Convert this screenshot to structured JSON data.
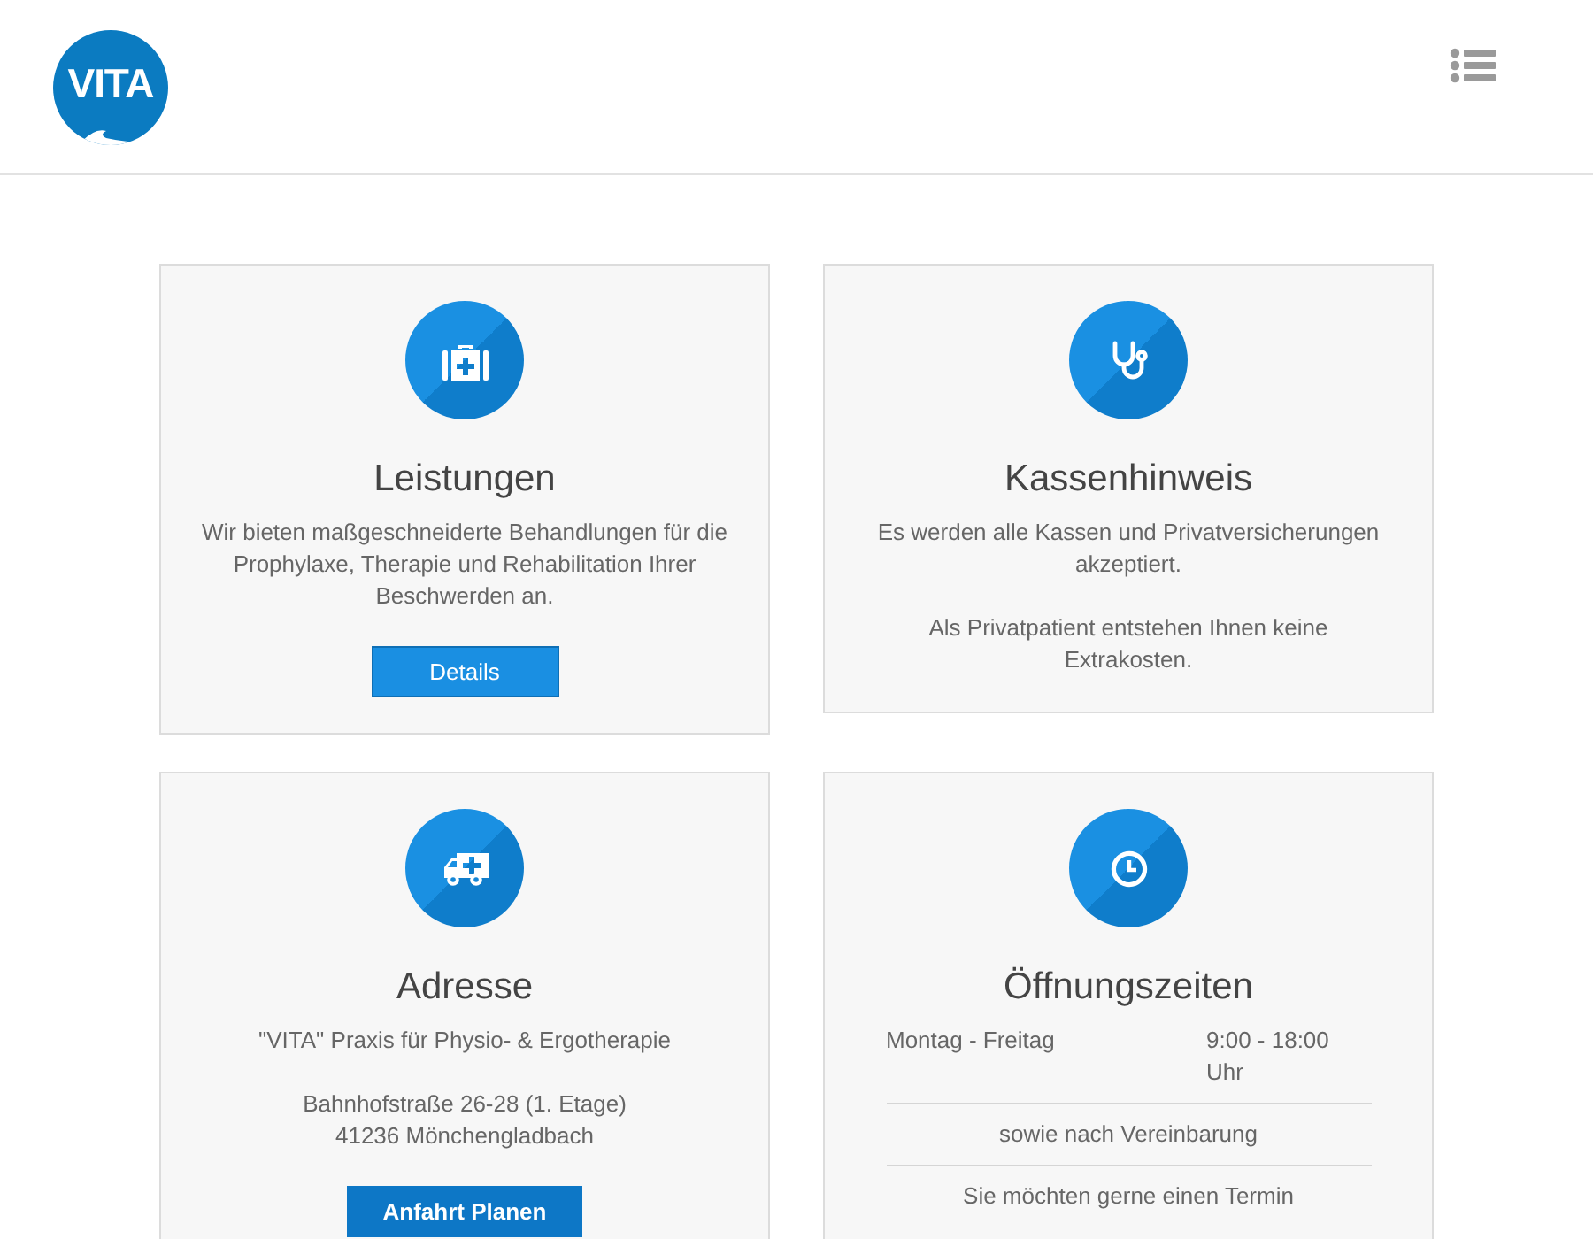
{
  "header": {
    "logo_text": "VITA"
  },
  "cards": [
    {
      "title": "Leistungen",
      "blocks": [
        {
          "kind": "paragraph",
          "lines": [
            "Wir bieten maßgeschneiderte Behandlungen für die Prophylaxe, Therapie und Rehabilitation Ihrer Beschwerden an."
          ]
        },
        {
          "kind": "button",
          "label": "Details",
          "bold": false
        }
      ]
    },
    {
      "title": "Kassenhinweis",
      "blocks": [
        {
          "kind": "paragraph",
          "lines": [
            "Es werden alle Kassen und Privatversicherungen akzeptiert."
          ]
        },
        {
          "kind": "paragraph",
          "lines": [
            "Als Privatpatient entstehen Ihnen keine Extrakosten."
          ]
        }
      ]
    },
    {
      "title": "Adresse",
      "blocks": [
        {
          "kind": "paragraph",
          "lines": [
            "\"VITA\" Praxis für Physio- & Ergotherapie"
          ]
        },
        {
          "kind": "paragraph",
          "lines": [
            "Bahnhofstraße 26-28 (1. Etage)",
            "41236 Mönchengladbach"
          ]
        },
        {
          "kind": "button",
          "label": "Anfahrt Planen",
          "bold": true
        }
      ]
    },
    {
      "title": "Öffnungszeiten",
      "blocks": [
        {
          "kind": "hours",
          "day": "Montag - Freitag",
          "time": "9:00 - 18:00 Uhr"
        },
        {
          "kind": "note",
          "text": "sowie nach Vereinbarung"
        },
        {
          "kind": "note",
          "text": "Sie möchten gerne einen Termin"
        }
      ]
    }
  ]
}
